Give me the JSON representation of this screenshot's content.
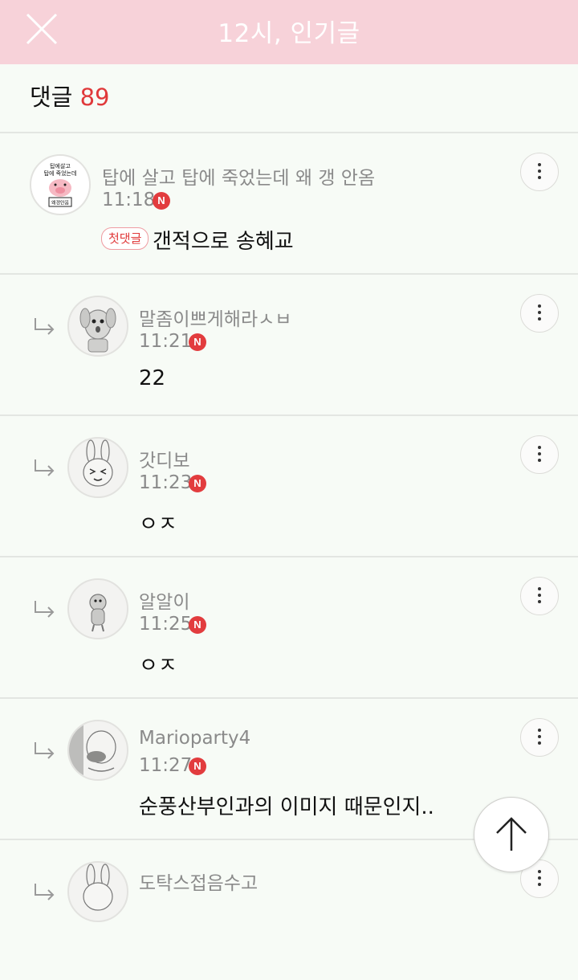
{
  "header": {
    "title": "12시, 인기글",
    "close_icon": "close-icon"
  },
  "comment_count": {
    "label": "댓글",
    "count": "89"
  },
  "comments": [
    {
      "author": "탑에 살고 탑에 죽었는데 왜 갱 안옴",
      "time": "11:18",
      "badge": "N",
      "first_label": "첫댓글",
      "text": "갠적으로 송혜교",
      "avatar_icon": "pig-sticker-avatar",
      "avatar_text": [
        "탑에살고",
        "탑에 죽었는데",
        "왜갱안옴"
      ]
    },
    {
      "author": "말좀이쁘게해라ㅅㅂ",
      "time": "11:21",
      "badge": "N",
      "text": "22",
      "avatar_icon": "dog-character-avatar"
    },
    {
      "author": "갓디보",
      "time": "11:23",
      "badge": "N",
      "text": "ㅇㅈ",
      "avatar_icon": "rabbit-character-avatar"
    },
    {
      "author": "알알이",
      "time": "11:25",
      "badge": "N",
      "text": "ㅇㅈ",
      "avatar_icon": "character-avatar"
    },
    {
      "author": "Marioparty4",
      "time": "11:27",
      "badge": "N",
      "text": "순풍산부인과의 이미지 때문인지..",
      "avatar_icon": "bald-character-avatar"
    },
    {
      "author": "도탁스접음수고",
      "avatar_icon": "rabbit-character-avatar"
    }
  ],
  "scroll_top_icon": "arrow-up-icon",
  "colors": {
    "header_bg": "#f7d2d9",
    "accent_red": "#e0393a",
    "page_bg": "#f7fbf6"
  }
}
